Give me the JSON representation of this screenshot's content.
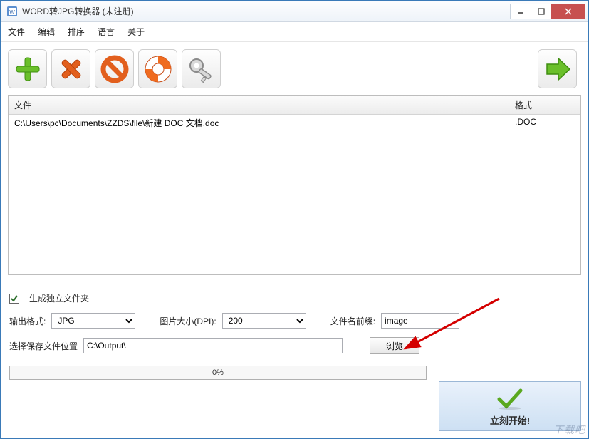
{
  "titlebar": {
    "title": "WORD转JPG转换器 (未注册)"
  },
  "menu": {
    "file": "文件",
    "edit": "编辑",
    "sort": "排序",
    "lang": "语言",
    "about": "关于"
  },
  "table": {
    "col_file": "文件",
    "col_format": "格式",
    "rows": [
      {
        "path": "C:\\Users\\pc\\Documents\\ZZDS\\file\\新建 DOC 文档.doc",
        "format": ".DOC"
      }
    ]
  },
  "options": {
    "gen_folder_label": "生成独立文件夹",
    "gen_folder_checked": true,
    "out_format_label": "输出格式:",
    "out_format_value": "JPG",
    "dpi_label": "图片大小(DPI):",
    "dpi_value": "200",
    "prefix_label": "文件名前缀:",
    "prefix_value": "image",
    "output_label": "选择保存文件位置",
    "output_value": "C:\\Output\\",
    "browse_label": "浏览"
  },
  "progress": {
    "text": "0%"
  },
  "start": {
    "label": "立刻开始!"
  },
  "watermark": "下载吧"
}
